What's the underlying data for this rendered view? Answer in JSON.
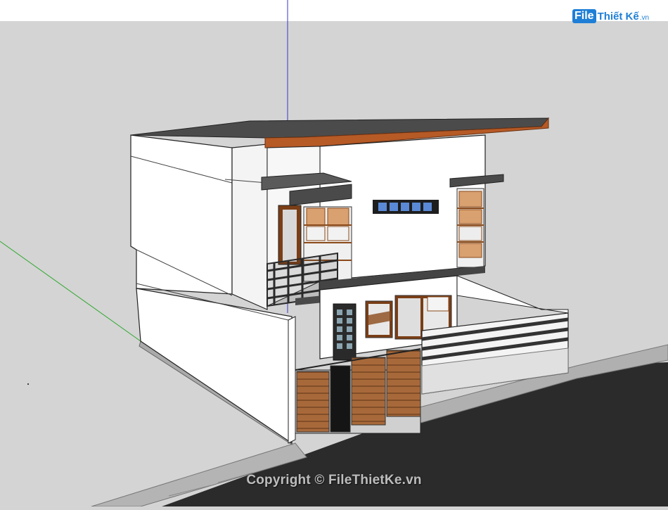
{
  "app": {
    "view": "3D model viewport"
  },
  "watermark": {
    "logo_primary": "File",
    "logo_secondary": "Thiết Kế",
    "logo_suffix": ".vn"
  },
  "copyright": "Copyright © FileThietKe.vn",
  "colors": {
    "sky": "#ffffff",
    "ground": "#d4d4d4",
    "wall": "#ffffff",
    "roof_trim": "#b65a26",
    "window_frame": "#8a4a1a",
    "gate_wood": "#a8693a",
    "dark_trim": "#3c3c3c",
    "road": "#2b2b2b",
    "sidewalk": "#b8b8b8",
    "axis_blue": "#3a35c8",
    "axis_green": "#2fa82f",
    "logo_blue": "#1f7fd6"
  }
}
